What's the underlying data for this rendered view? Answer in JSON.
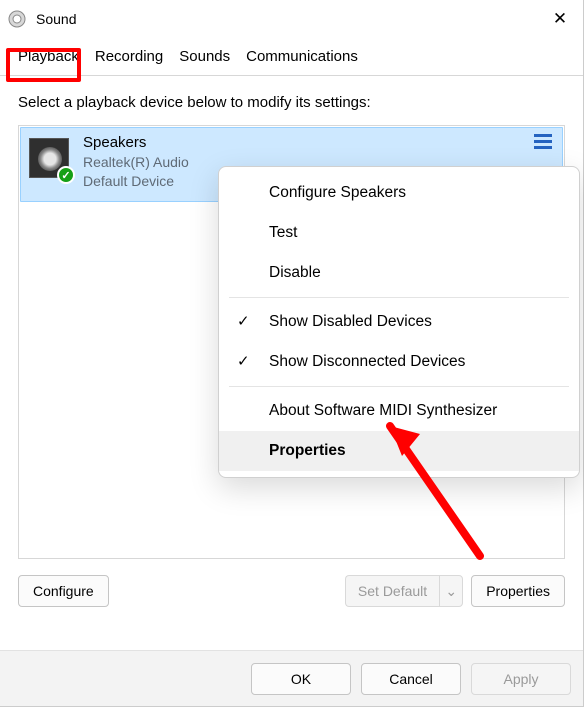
{
  "window": {
    "title": "Sound"
  },
  "tabs": {
    "playback": "Playback",
    "recording": "Recording",
    "sounds": "Sounds",
    "communications": "Communications",
    "active": "playback"
  },
  "instruction": "Select a playback device below to modify its settings:",
  "devices": [
    {
      "name": "Speakers",
      "driver": "Realtek(R) Audio",
      "status": "Default Device",
      "selected": true,
      "has_check": true
    }
  ],
  "context_menu": {
    "items": [
      {
        "label": "Configure Speakers",
        "checked": false
      },
      {
        "label": "Test",
        "checked": false
      },
      {
        "label": "Disable",
        "checked": false
      }
    ],
    "items2": [
      {
        "label": "Show Disabled Devices",
        "checked": true
      },
      {
        "label": "Show Disconnected Devices",
        "checked": true
      }
    ],
    "items3": [
      {
        "label": "About Software MIDI Synthesizer",
        "checked": false
      },
      {
        "label": "Properties",
        "checked": false,
        "highlight": true
      }
    ]
  },
  "buttons": {
    "configure": "Configure",
    "set_default": "Set Default",
    "properties": "Properties",
    "ok": "OK",
    "cancel": "Cancel",
    "apply": "Apply"
  },
  "annotation": {
    "arrow_color": "#ff0000",
    "highlight_tab": "playback"
  },
  "glyphs": {
    "close": "✕",
    "check": "✓",
    "chevron_down": "⌄"
  }
}
